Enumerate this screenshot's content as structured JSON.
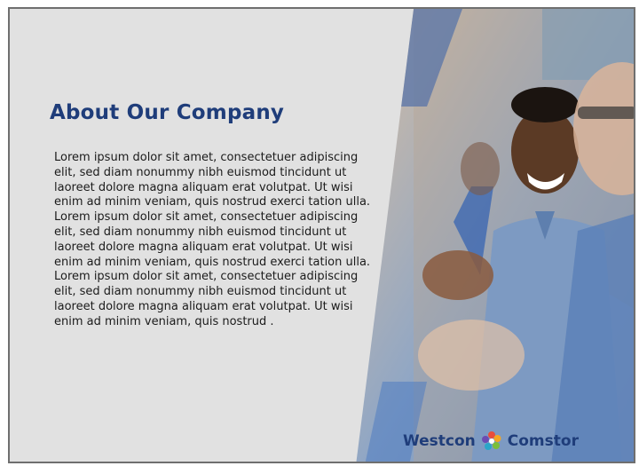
{
  "slide": {
    "title": "About Our Company",
    "paragraph_1": "Lorem ipsum dolor sit amet, consectetuer adipiscing elit, sed diam nonummy nibh euismod tincidunt ut laoreet dolore magna aliquam erat volutpat. Ut wisi enim ad minim veniam, quis nostrud exerci tation ulla. Lorem ipsum dolor sit amet, consectetuer adipiscing elit, sed diam nonummy nibh euismod tincidunt ut laoreet dolore magna aliquam erat volutpat. Ut wisi enim ad minim veniam, quis nostrud exerci tation ulla.",
    "paragraph_2": "Lorem ipsum dolor sit amet, consectetuer adipiscing elit, sed diam nonummy nibh euismod tincidunt ut laoreet dolore magna aliquam erat volutpat. Ut wisi enim ad minim veniam, quis nostrud ."
  },
  "logo": {
    "left_word": "Westcon",
    "right_word": "Comstor",
    "brand_color": "#1f3d7a"
  },
  "photo": {
    "icon": "people-clapping-photo"
  }
}
